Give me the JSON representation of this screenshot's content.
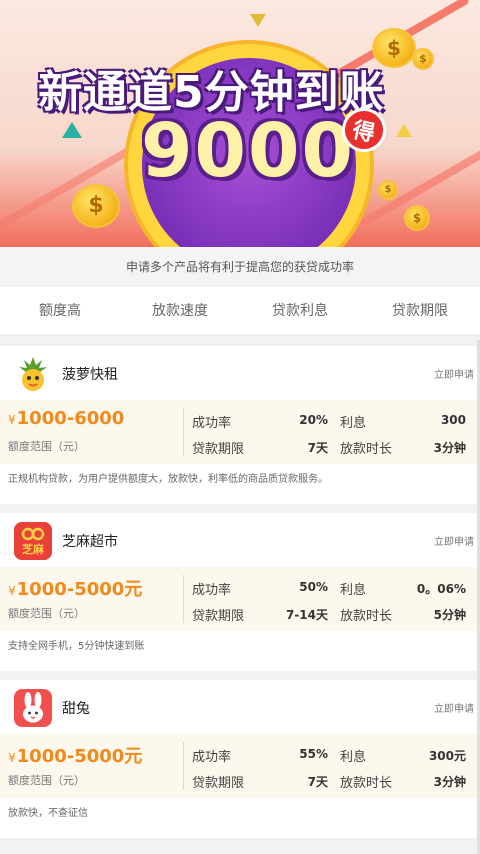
{
  "banner": {
    "headline": "新通道5分钟到账",
    "amount": "9000",
    "badge": "得",
    "coin_symbol": "$",
    "colors": {
      "bg": "#f7d7cb",
      "circle": "#7a2fb8",
      "ring": "#ffd63d",
      "badge": "#e8312f"
    }
  },
  "tip": "申请多个产品将有利于提高您的获贷成功率",
  "filters": [
    "额度高",
    "放款速度",
    "贷款利息",
    "贷款期限"
  ],
  "labels": {
    "apply": "立即申请",
    "amount_range": "额度范围（元）",
    "success_rate": "成功率",
    "loan_term": "贷款期限",
    "interest": "利息",
    "payout_time": "放款时长",
    "yen": "¥"
  },
  "products": [
    {
      "name": "菠萝快租",
      "icon": "pineapple-icon",
      "amount": "1000-6000",
      "success_rate": "20%",
      "loan_term": "7天",
      "interest": "300",
      "payout_time": "3分钟",
      "desc": "正规机构贷款，为用户提供额度大，放款快，利率低的商品质贷款服务。"
    },
    {
      "name": "芝麻超市",
      "icon": "zhima-icon",
      "icon_text": "芝麻",
      "amount": "1000-5000元",
      "success_rate": "50%",
      "loan_term": "7-14天",
      "interest": "0。06%",
      "payout_time": "5分钟",
      "desc": "支持全网手机，5分钟快速到账"
    },
    {
      "name": "甜兔",
      "icon": "rabbit-icon",
      "amount": "1000-5000元",
      "success_rate": "55%",
      "loan_term": "7天",
      "interest": "300元",
      "payout_time": "3分钟",
      "desc": "放款快，不查征信"
    }
  ],
  "accent_color": "#f08a1d"
}
